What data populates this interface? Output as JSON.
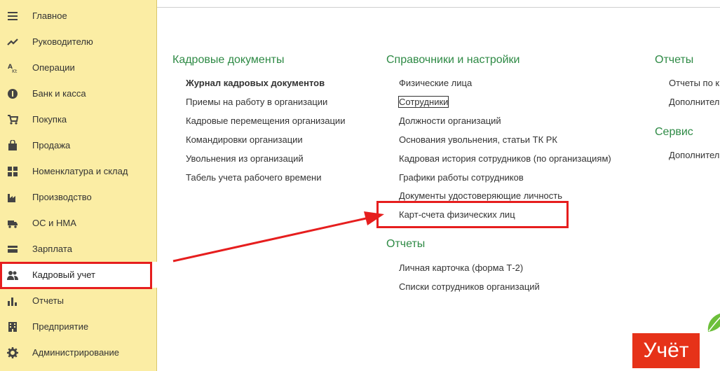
{
  "sidebar": {
    "items": [
      {
        "label": "Главное",
        "icon": "menu-lines-icon"
      },
      {
        "label": "Руководителю",
        "icon": "trend-line-icon"
      },
      {
        "label": "Операции",
        "icon": "operations-icon"
      },
      {
        "label": "Банк и касса",
        "icon": "coin-icon"
      },
      {
        "label": "Покупка",
        "icon": "cart-icon"
      },
      {
        "label": "Продажа",
        "icon": "bag-icon"
      },
      {
        "label": "Номенклатура и склад",
        "icon": "grid-icon"
      },
      {
        "label": "Производство",
        "icon": "factory-icon"
      },
      {
        "label": "ОС и НМА",
        "icon": "truck-icon"
      },
      {
        "label": "Зарплата",
        "icon": "wallet-icon"
      },
      {
        "label": "Кадровый учет",
        "icon": "users-icon"
      },
      {
        "label": "Отчеты",
        "icon": "bar-chart-icon"
      },
      {
        "label": "Предприятие",
        "icon": "building-icon"
      },
      {
        "label": "Администрирование",
        "icon": "gear-icon"
      }
    ],
    "active_label": "Кадровый учет"
  },
  "sections": {
    "hr_docs": {
      "title": "Кадровые документы",
      "links": [
        "Журнал кадровых документов",
        "Приемы на работу в организации",
        "Кадровые перемещения организации",
        "Командировки организации",
        "Увольнения из организаций",
        "Табель учета рабочего времени"
      ]
    },
    "refs": {
      "title": "Справочники и настройки",
      "links": [
        "Физические лица",
        "Сотрудники",
        "Должности организаций",
        "Основания увольнения, статьи ТК РК",
        "Кадровая история сотрудников (по организациям)",
        "Графики работы сотрудников",
        "Документы удостоверяющие личность",
        "Карт-счета физических лиц"
      ]
    },
    "reports_mid": {
      "title": "Отчеты",
      "links": [
        "Личная карточка (форма Т-2)",
        "Списки сотрудников организаций"
      ]
    },
    "reports_right": {
      "title": "Отчеты",
      "links": [
        "Отчеты по к",
        "Дополнител"
      ]
    },
    "service": {
      "title": "Сервис",
      "links": [
        "Дополнител"
      ]
    }
  },
  "logo": {
    "text": "Учёт"
  },
  "colors": {
    "sidebar_bg": "#fbeda4",
    "section_title": "#2e8a45",
    "highlight": "#e61e1e",
    "logo_bg": "#e63219"
  }
}
